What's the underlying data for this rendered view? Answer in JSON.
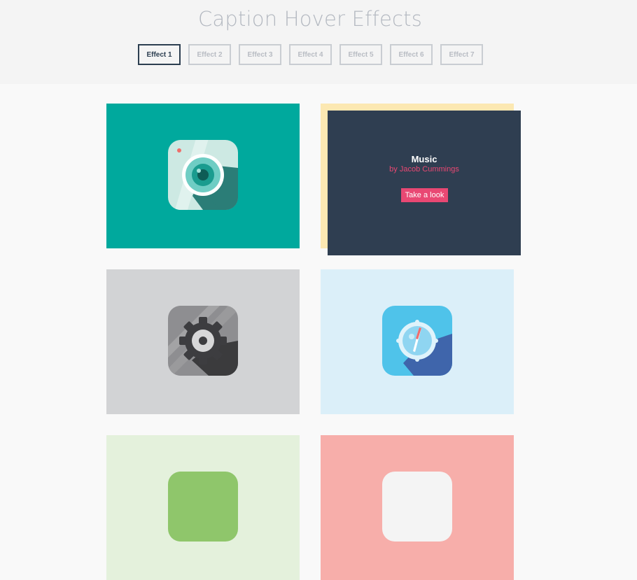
{
  "header": {
    "title": "Caption Hover Effects"
  },
  "nav": {
    "items": [
      {
        "label": "Effect 1",
        "active": true
      },
      {
        "label": "Effect 2",
        "active": false
      },
      {
        "label": "Effect 3",
        "active": false
      },
      {
        "label": "Effect 4",
        "active": false
      },
      {
        "label": "Effect 5",
        "active": false
      },
      {
        "label": "Effect 6",
        "active": false
      },
      {
        "label": "Effect 7",
        "active": false
      }
    ]
  },
  "grid": {
    "items": [
      {
        "icon": "camera-icon",
        "bg": "#00a99d"
      },
      {
        "icon": "headphones-icon",
        "bg": "#fce8b2",
        "caption": {
          "title": "Music",
          "author": "by Jacob Cummings",
          "button": "Take a look"
        }
      },
      {
        "icon": "settings-gear-icon",
        "bg": "#d2d3d5"
      },
      {
        "icon": "compass-icon",
        "bg": "#dbeff9"
      },
      {
        "icon": "app-icon",
        "bg": "#e4f1dc"
      },
      {
        "icon": "app-icon",
        "bg": "#f7aeaa"
      }
    ]
  },
  "colors": {
    "accent": "#e94873",
    "active_border": "#2c3e50",
    "caption_bg": "#2f3e51"
  }
}
